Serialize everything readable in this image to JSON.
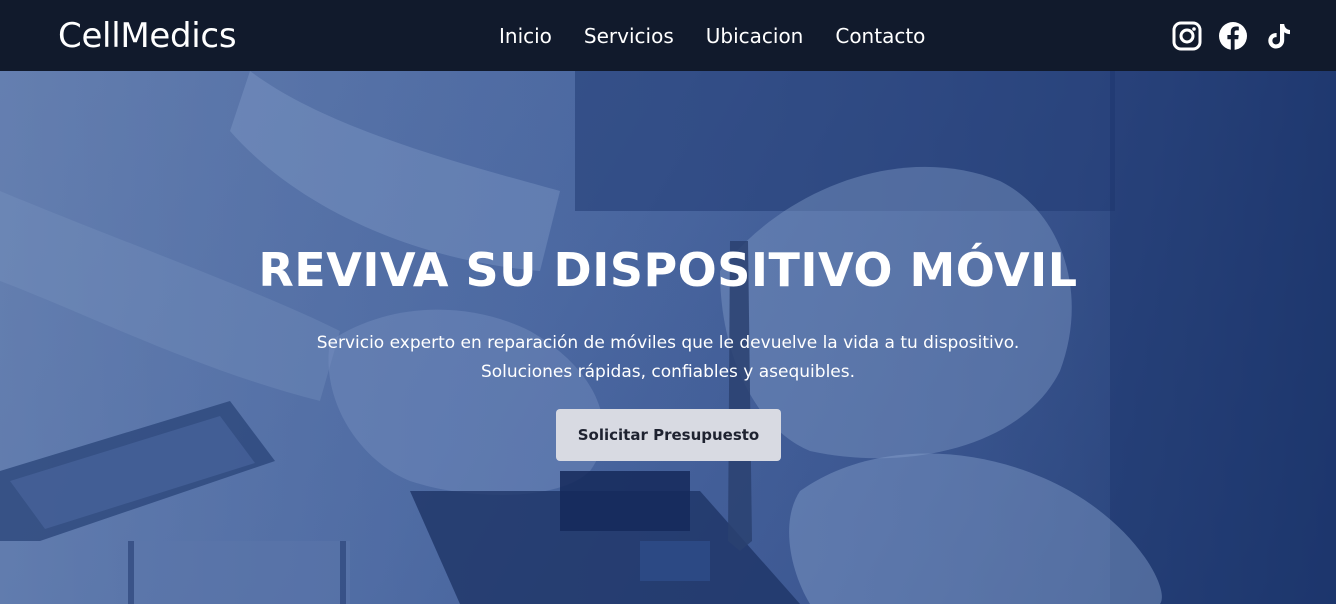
{
  "brand": {
    "name": "CellMedics"
  },
  "nav": {
    "links": [
      {
        "label": "Inicio"
      },
      {
        "label": "Servicios"
      },
      {
        "label": "Ubicacion"
      },
      {
        "label": "Contacto"
      }
    ]
  },
  "socials": [
    {
      "icon": "instagram-icon"
    },
    {
      "icon": "facebook-icon"
    },
    {
      "icon": "tiktok-icon"
    }
  ],
  "hero": {
    "title": "REVIVA SU DISPOSITIVO MÓVIL",
    "subtitle_line1": "Servicio experto en reparación de móviles que le devuelve la vida a tu dispositivo.",
    "subtitle_line2": "Soluciones rápidas, confiables y asequibles.",
    "cta_label": "Solicitar Presupuesto"
  },
  "colors": {
    "navbar_bg": "#111a2c",
    "hero_overlay": "#3a5590",
    "cta_bg": "#d8dae2",
    "text_light": "#ffffff"
  }
}
